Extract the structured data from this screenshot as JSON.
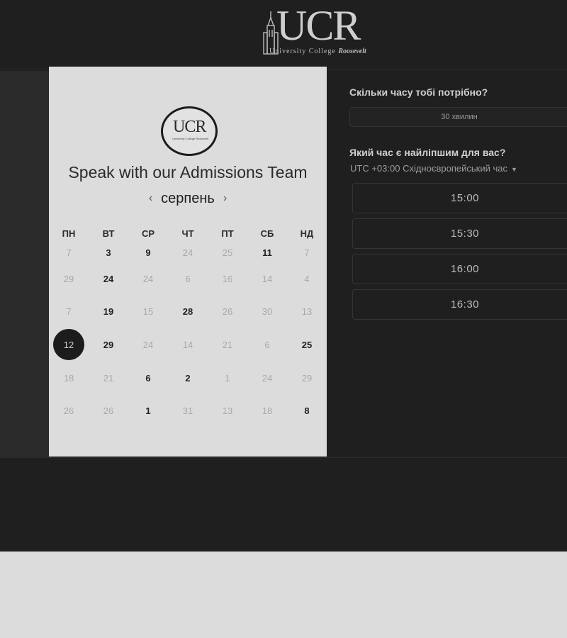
{
  "header": {
    "logo_text": "UCR",
    "logo_subtitle_plain": "University College ",
    "logo_subtitle_italic": "Roosevelt"
  },
  "card": {
    "badge_text": "UCR",
    "badge_subtitle": "University College Roosevelt",
    "title": "Speak with our Admissions Team",
    "month": "серпень",
    "prev_icon": "‹",
    "next_icon": "›",
    "weekdays": [
      "ПН",
      "ВТ",
      "СР",
      "ЧТ",
      "ПТ",
      "СБ",
      "НД"
    ],
    "weeks": [
      [
        {
          "d": "7",
          "s": "off"
        },
        {
          "d": "3",
          "s": "on"
        },
        {
          "d": "9",
          "s": "on"
        },
        {
          "d": "24",
          "s": "off"
        },
        {
          "d": "25",
          "s": "off"
        },
        {
          "d": "11",
          "s": "on"
        },
        {
          "d": "7",
          "s": "off"
        }
      ],
      [
        {
          "d": "29",
          "s": "off"
        },
        {
          "d": "24",
          "s": "on"
        },
        {
          "d": "24",
          "s": "off"
        },
        {
          "d": "6",
          "s": "off"
        },
        {
          "d": "16",
          "s": "off"
        },
        {
          "d": "14",
          "s": "off"
        },
        {
          "d": "4",
          "s": "off"
        }
      ],
      [
        {
          "d": "7",
          "s": "off"
        },
        {
          "d": "19",
          "s": "on"
        },
        {
          "d": "15",
          "s": "off"
        },
        {
          "d": "28",
          "s": "on"
        },
        {
          "d": "26",
          "s": "off"
        },
        {
          "d": "30",
          "s": "off"
        },
        {
          "d": "13",
          "s": "off"
        }
      ],
      [
        {
          "d": "12",
          "s": "sel"
        },
        {
          "d": "29",
          "s": "on"
        },
        {
          "d": "24",
          "s": "off"
        },
        {
          "d": "14",
          "s": "off"
        },
        {
          "d": "21",
          "s": "off"
        },
        {
          "d": "6",
          "s": "off"
        },
        {
          "d": "25",
          "s": "on"
        }
      ],
      [
        {
          "d": "18",
          "s": "off"
        },
        {
          "d": "21",
          "s": "off"
        },
        {
          "d": "6",
          "s": "on"
        },
        {
          "d": "2",
          "s": "on"
        },
        {
          "d": "1",
          "s": "off"
        },
        {
          "d": "24",
          "s": "off"
        },
        {
          "d": "29",
          "s": "off"
        }
      ],
      [
        {
          "d": "26",
          "s": "off"
        },
        {
          "d": "26",
          "s": "off"
        },
        {
          "d": "1",
          "s": "on"
        },
        {
          "d": "31",
          "s": "off"
        },
        {
          "d": "13",
          "s": "off"
        },
        {
          "d": "18",
          "s": "off"
        },
        {
          "d": "8",
          "s": "on"
        }
      ]
    ]
  },
  "booking": {
    "duration_question": "Скільки часу тобі потрібно?",
    "duration_value": "30 хвилин",
    "time_question": "Який час є найліпшим для вас?",
    "timezone": "UTC +03:00 Східноєвропейський час",
    "timezone_caret": "▼",
    "slots": [
      "15:00",
      "15:30",
      "16:00",
      "16:30"
    ]
  }
}
